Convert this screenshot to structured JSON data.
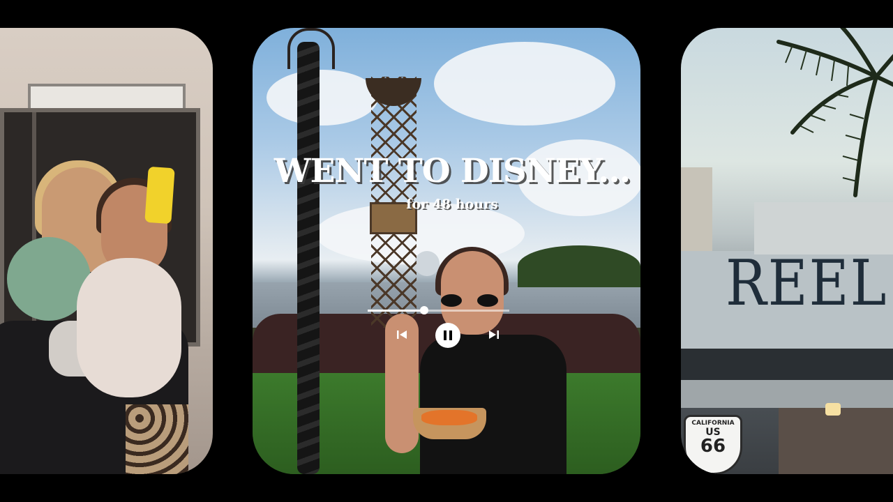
{
  "overlay": {
    "title": "WENT TO DISNEY...",
    "subtitle": "for 48 hours"
  },
  "player": {
    "progress_fraction": 0.4,
    "state": "playing",
    "prev_icon": "skip-previous-icon",
    "pause_icon": "pause-icon",
    "next_icon": "skip-next-icon"
  },
  "right_scene": {
    "sign_text": "REEL VOGUE",
    "road_shield": {
      "state": "CALIFORNIA",
      "country": "US",
      "number": "66"
    }
  },
  "colors": {
    "background": "#000000",
    "accent": "#ffffff"
  }
}
